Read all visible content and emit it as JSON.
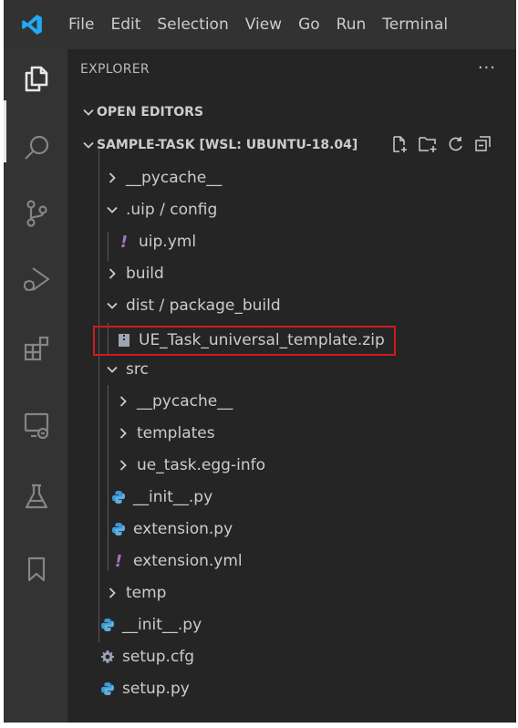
{
  "menu": [
    "File",
    "Edit",
    "Selection",
    "View",
    "Go",
    "Run",
    "Terminal"
  ],
  "explorer": {
    "title": "EXPLORER",
    "more": "···",
    "open_editors": "OPEN EDITORS",
    "workspace": "SAMPLE-TASK [WSL: UBUNTU-18.04]"
  },
  "tree": [
    {
      "label": "__pycache__",
      "type": "folder",
      "expanded": false
    },
    {
      "label": ".uip / config",
      "type": "folder",
      "expanded": true
    },
    {
      "label": "uip.yml",
      "type": "yml"
    },
    {
      "label": "build",
      "type": "folder",
      "expanded": false
    },
    {
      "label": "dist / package_build",
      "type": "folder",
      "expanded": true
    },
    {
      "label": "UE_Task_universal_template.zip",
      "type": "zip",
      "highlighted": true
    },
    {
      "label": "src",
      "type": "folder",
      "expanded": true
    },
    {
      "label": "__pycache__",
      "type": "folder",
      "expanded": false
    },
    {
      "label": "templates",
      "type": "folder",
      "expanded": false
    },
    {
      "label": "ue_task.egg-info",
      "type": "folder",
      "expanded": false
    },
    {
      "label": "__init__.py",
      "type": "python"
    },
    {
      "label": "extension.py",
      "type": "python"
    },
    {
      "label": "extension.yml",
      "type": "yml"
    },
    {
      "label": "temp",
      "type": "folder",
      "expanded": false
    },
    {
      "label": "__init__.py",
      "type": "python"
    },
    {
      "label": "setup.cfg",
      "type": "cfg"
    },
    {
      "label": "setup.py",
      "type": "python"
    }
  ],
  "colors": {
    "highlight_border": "#d11a1a",
    "python_icon": "#3c9bd6",
    "yml_icon": "#a074c4",
    "logo": "#23a9f2"
  }
}
